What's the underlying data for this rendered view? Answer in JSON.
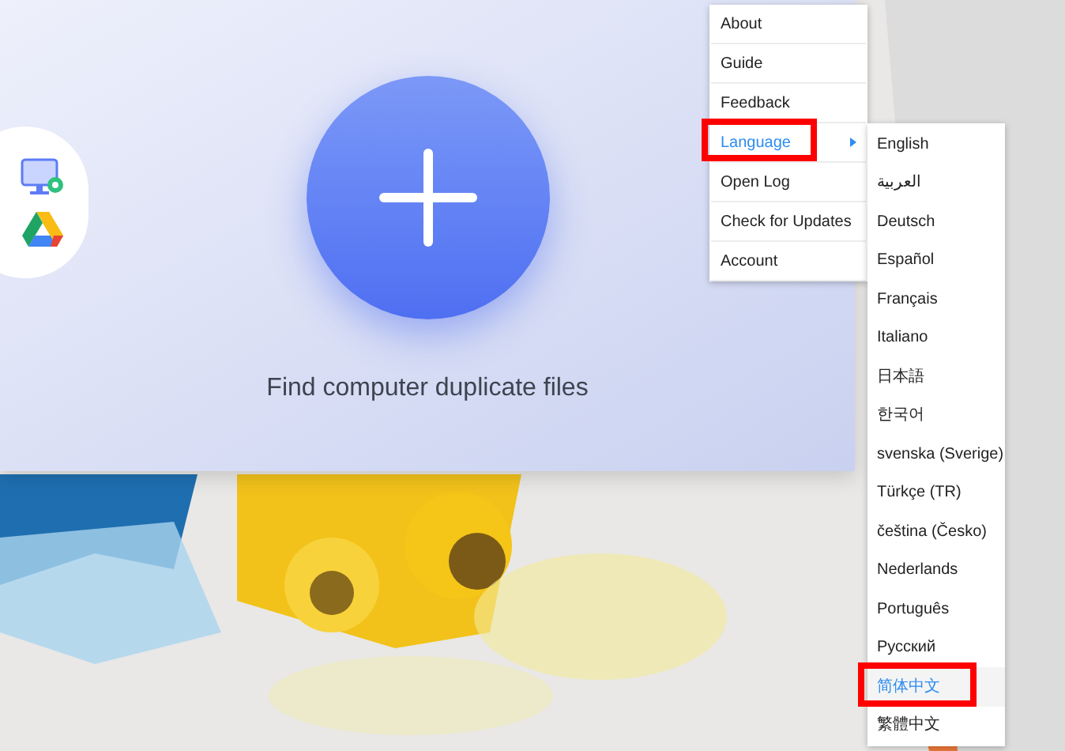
{
  "sources": [
    {
      "kind": "computer"
    },
    {
      "kind": "drive"
    }
  ],
  "main_action": {
    "label": "Find computer duplicate files"
  },
  "menu": [
    {
      "label": "About",
      "selected": false,
      "has_submenu": false,
      "highlight_frame": false
    },
    {
      "label": "Guide",
      "selected": false,
      "has_submenu": false,
      "highlight_frame": false
    },
    {
      "label": "Feedback",
      "selected": false,
      "has_submenu": false,
      "highlight_frame": false
    },
    {
      "label": "Language",
      "selected": true,
      "has_submenu": true,
      "highlight_frame": true
    },
    {
      "label": "Open Log",
      "selected": false,
      "has_submenu": false,
      "highlight_frame": false
    },
    {
      "label": "Check for Updates",
      "selected": false,
      "has_submenu": false,
      "highlight_frame": false
    },
    {
      "label": "Account",
      "selected": false,
      "has_submenu": false,
      "highlight_frame": false
    }
  ],
  "languages": [
    {
      "label": "English",
      "selected": false,
      "highlight_frame": false
    },
    {
      "label": "العربية",
      "selected": false,
      "highlight_frame": false
    },
    {
      "label": "Deutsch",
      "selected": false,
      "highlight_frame": false
    },
    {
      "label": "Español",
      "selected": false,
      "highlight_frame": false
    },
    {
      "label": "Français",
      "selected": false,
      "highlight_frame": false
    },
    {
      "label": "Italiano",
      "selected": false,
      "highlight_frame": false
    },
    {
      "label": "日本語",
      "selected": false,
      "highlight_frame": false
    },
    {
      "label": "한국어",
      "selected": false,
      "highlight_frame": false
    },
    {
      "label": "svenska (Sverige)",
      "selected": false,
      "highlight_frame": false
    },
    {
      "label": "Türkçe (TR)",
      "selected": false,
      "highlight_frame": false
    },
    {
      "label": "čeština (Česko)",
      "selected": false,
      "highlight_frame": false
    },
    {
      "label": "Nederlands",
      "selected": false,
      "highlight_frame": false
    },
    {
      "label": "Português",
      "selected": false,
      "highlight_frame": false
    },
    {
      "label": "Русский",
      "selected": false,
      "highlight_frame": false
    },
    {
      "label": "简体中文",
      "selected": true,
      "highlight_frame": true
    },
    {
      "label": "繁體中文",
      "selected": false,
      "highlight_frame": false
    }
  ]
}
